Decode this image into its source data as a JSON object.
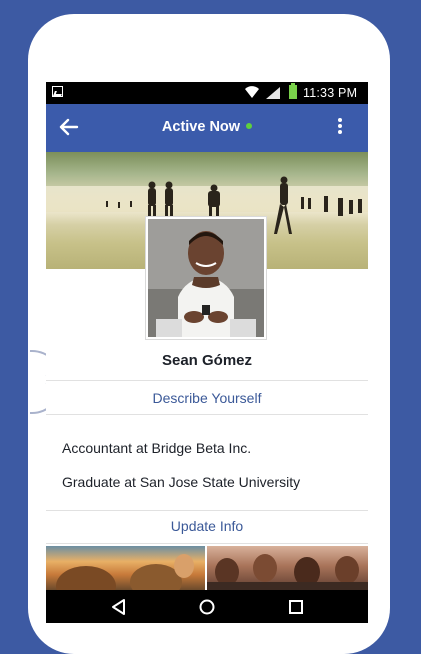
{
  "status_bar": {
    "time": "11:33 PM",
    "icons": [
      "image-notification-icon",
      "wifi-icon",
      "signal-icon",
      "battery-icon"
    ]
  },
  "app_bar": {
    "title": "Active Now",
    "status_color": "#5fd13c",
    "back_icon": "back-arrow-icon",
    "menu_icon": "overflow-menu-icon"
  },
  "profile": {
    "name": "Sean Gómez",
    "describe_label": "Describe Yourself",
    "info": [
      "Accountant at Bridge Beta Inc.",
      "Graduate at San Jose State University"
    ],
    "update_label": "Update Info"
  },
  "colors": {
    "background": "#3d5aa3",
    "app_bar": "#3b5bab",
    "link": "#3b5998"
  },
  "nav_bar": {
    "icons": [
      "back-triangle-icon",
      "home-circle-icon",
      "recents-square-icon"
    ]
  }
}
